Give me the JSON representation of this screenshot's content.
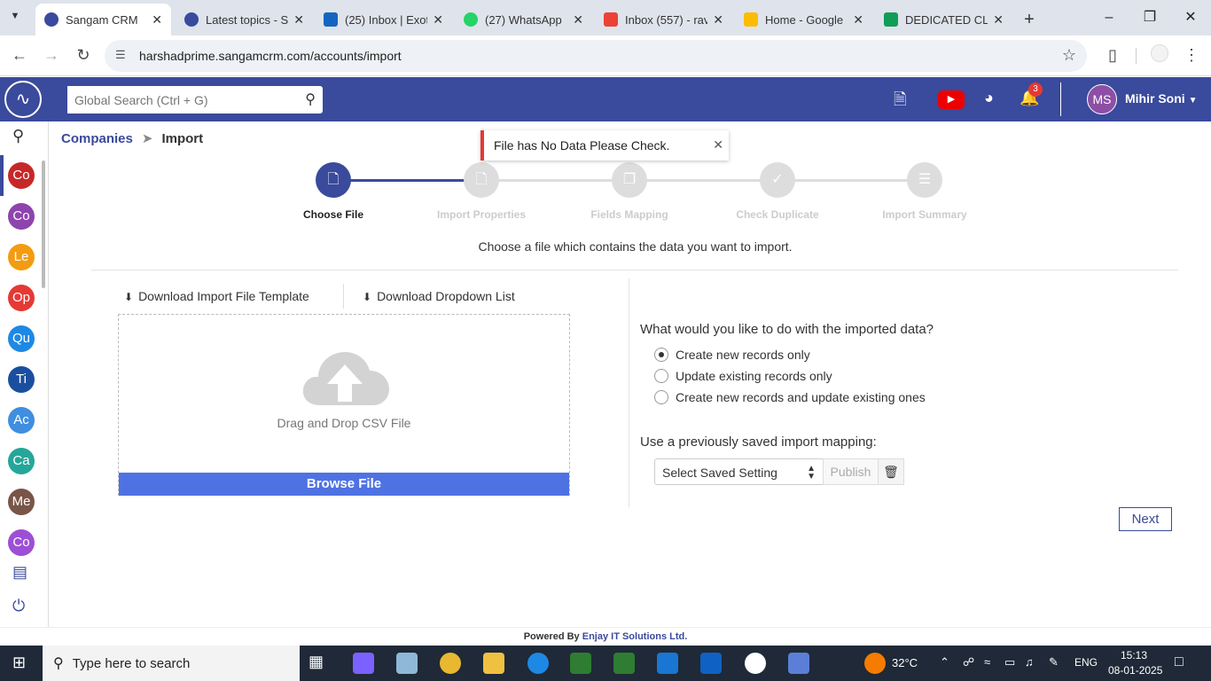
{
  "browser": {
    "tabs": [
      {
        "title": "Sangam CRM",
        "active": true
      },
      {
        "title": "Latest topics - S",
        "active": false
      },
      {
        "title": "(25) Inbox | Exot",
        "active": false
      },
      {
        "title": "(27) WhatsApp",
        "active": false
      },
      {
        "title": "Inbox (557) - rav",
        "active": false
      },
      {
        "title": "Home - Google",
        "active": false
      },
      {
        "title": "DEDICATED CLO",
        "active": false
      }
    ],
    "url": "harshadprime.sangamcrm.com/accounts/import"
  },
  "header": {
    "search_placeholder": "Global Search (Ctrl + G)",
    "notification_count": "3",
    "user_initials": "MS",
    "user_name": "Mihir Soni"
  },
  "sidebar": {
    "items": [
      {
        "label": "Co",
        "color": "#c62828"
      },
      {
        "label": "Co",
        "color": "#8e44ad"
      },
      {
        "label": "Le",
        "color": "#f39c12"
      },
      {
        "label": "Op",
        "color": "#e53935"
      },
      {
        "label": "Qu",
        "color": "#1e88e5"
      },
      {
        "label": "Ti",
        "color": "#1a4fa0"
      },
      {
        "label": "Ac",
        "color": "#3f8ee0"
      },
      {
        "label": "Ca",
        "color": "#26a69a"
      },
      {
        "label": "Me",
        "color": "#795548"
      },
      {
        "label": "Co",
        "color": "#9c4fd6"
      }
    ]
  },
  "breadcrumb": {
    "parent": "Companies",
    "current": "Import"
  },
  "toast": {
    "message": "File has No Data Please Check."
  },
  "steps": [
    {
      "label": "Choose File",
      "active": true
    },
    {
      "label": "Import Properties",
      "active": false
    },
    {
      "label": "Fields Mapping",
      "active": false
    },
    {
      "label": "Check Duplicate",
      "active": false
    },
    {
      "label": "Import Summary",
      "active": false
    }
  ],
  "instruction": "Choose a file which contains the data you want to import.",
  "left_panel": {
    "download_template": "Download Import File Template",
    "download_dropdown": "Download Dropdown List",
    "drop_text": "Drag and Drop CSV File",
    "browse_label": "Browse File"
  },
  "right_panel": {
    "question": "What would you like to do with the imported data?",
    "options": [
      {
        "label": "Create new records only",
        "selected": true
      },
      {
        "label": "Update existing records only",
        "selected": false
      },
      {
        "label": "Create new records and update existing ones",
        "selected": false
      }
    ],
    "saved_label": "Use a previously saved import mapping:",
    "select_value": "Select Saved Setting",
    "publish_label": "Publish"
  },
  "next_label": "Next",
  "footer": {
    "prefix": "Powered By",
    "company": "Enjay IT Solutions Ltd."
  },
  "taskbar": {
    "search_placeholder": "Type here to search",
    "temperature": "32°C",
    "language": "ENG",
    "time": "15:13",
    "date": "08-01-2025"
  },
  "colors": {
    "brand": "#3a4a9c",
    "browse": "#4f72e3",
    "toast_border": "#e53935"
  }
}
